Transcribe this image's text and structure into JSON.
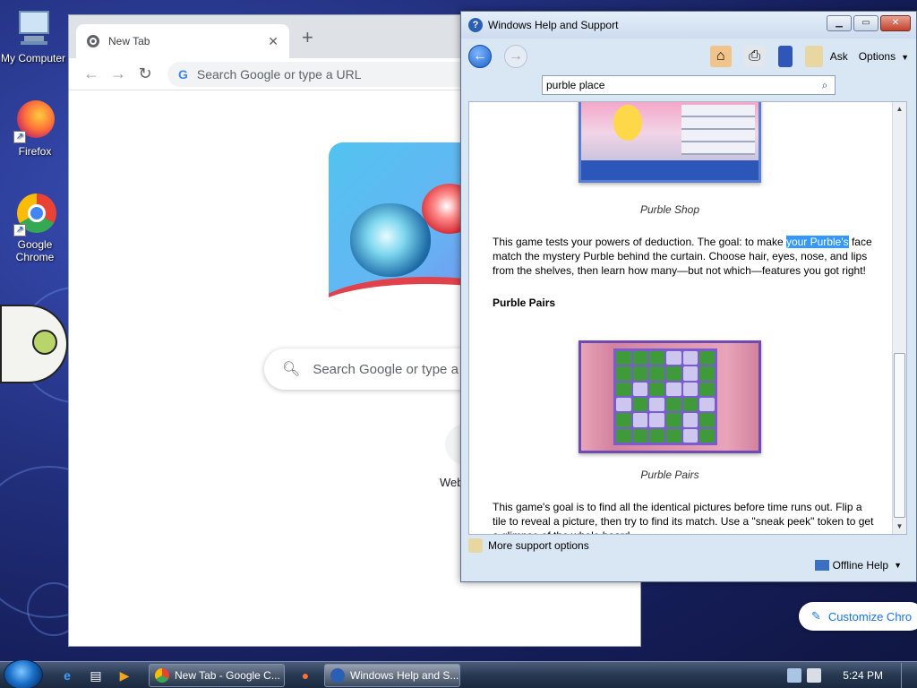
{
  "desktop": {
    "icons": [
      {
        "label": "My Computer"
      },
      {
        "label": "Firefox"
      },
      {
        "label": "Google Chrome"
      }
    ]
  },
  "chrome": {
    "tab_title": "New Tab",
    "tab_close": "✕",
    "new_tab": "+",
    "omnibox_placeholder": "Search Google or type a URL",
    "page_search_placeholder": "Search Google or type a",
    "shortcut_label": "Web",
    "customize_label": "Customize Chro"
  },
  "help": {
    "title": "Windows Help and Support",
    "toolbar": {
      "ask": "Ask",
      "options": "Options"
    },
    "search_value": "purble place",
    "article": {
      "caption_shop": "Purble Shop",
      "shop_text_before": "This game tests your powers of deduction. The goal: to make ",
      "shop_text_highlight": "your Purble's",
      "shop_text_after": " face match the mystery Purble behind the curtain. Choose hair, eyes, nose, and lips from the shelves, then learn how many—but not which—features you got right!",
      "heading_pairs": "Purble Pairs",
      "caption_pairs": "Purble Pairs",
      "pairs_text": "This game's goal is to find all the identical pictures before time runs out. Flip a tile to reveal a picture, then try to find its match. Use a \"sneak peek\" token to get a glimpse of the whole board."
    },
    "footer": {
      "more_support": "More support options",
      "offline": "Offline Help"
    }
  },
  "taskbar": {
    "chrome_task": "New Tab - Google C...",
    "help_task": "Windows Help and S...",
    "clock": "5:24 PM"
  }
}
